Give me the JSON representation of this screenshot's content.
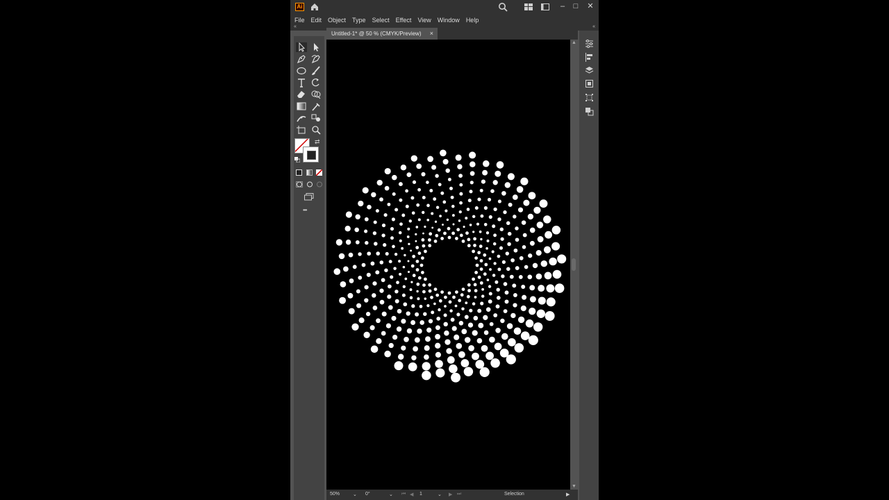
{
  "app": {
    "logo_text": "Ai",
    "colors": {
      "chrome": "#323232",
      "panel": "#535353",
      "toolbar": "#434343",
      "accent": "#ff9a00"
    }
  },
  "titlebar": {
    "icons": [
      "home-icon",
      "search-icon",
      "arrange-documents-icon",
      "workspace-icon"
    ],
    "window_controls": [
      "–",
      "□",
      "✕"
    ]
  },
  "menubar": {
    "items": [
      "File",
      "Edit",
      "Object",
      "Type",
      "Select",
      "Effect",
      "View",
      "Window",
      "Help"
    ]
  },
  "document": {
    "tab_title": "Untitled-1* @ 50 % (CMYK/Preview)",
    "close_label": "×"
  },
  "toolbar": {
    "tools": [
      "selection-tool",
      "direct-selection-tool",
      "pen-tool",
      "curvature-tool",
      "ellipse-tool",
      "paintbrush-tool",
      "type-tool",
      "rotate-tool",
      "eraser-tool",
      "shape-builder-tool",
      "gradient-tool",
      "eyedropper-tool",
      "width-tool",
      "blend-tool",
      "artboard-tool",
      "zoom-tool"
    ],
    "more_label": "•••"
  },
  "statusbar": {
    "zoom": "50%",
    "rotation": "0°",
    "artboard": "1",
    "tool_name": "Selection"
  },
  "artwork": {
    "description_colors": {
      "dots": "#ffffff",
      "background": "#000000"
    }
  }
}
